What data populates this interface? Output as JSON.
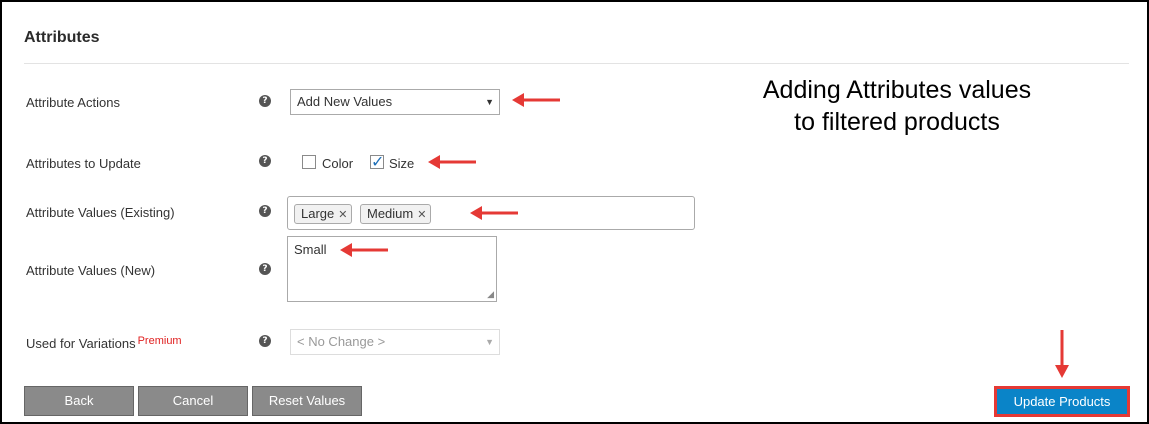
{
  "section": {
    "title": "Attributes"
  },
  "rows": {
    "actions": {
      "label": "Attribute Actions",
      "value": "Add New Values"
    },
    "update": {
      "label": "Attributes to Update",
      "options": [
        {
          "label": "Color",
          "checked": false
        },
        {
          "label": "Size",
          "checked": true
        }
      ]
    },
    "existing": {
      "label": "Attribute Values (Existing)",
      "tags": [
        "Large",
        "Medium"
      ]
    },
    "new": {
      "label": "Attribute Values (New)",
      "value": "Small"
    },
    "variations": {
      "label": "Used for Variations",
      "badge": "Premium",
      "value": "< No Change >"
    }
  },
  "help_glyph": "?",
  "buttons": {
    "back": "Back",
    "cancel": "Cancel",
    "reset": "Reset Values",
    "update": "Update Products"
  },
  "annotation": {
    "line1": "Adding Attributes values",
    "line2": "to filtered products"
  },
  "icons": {
    "help": "help-icon",
    "arrow": "red-arrow",
    "remove": "remove-tag-icon",
    "caret": "caret-down-icon",
    "check": "checkmark-icon"
  },
  "colors": {
    "primary": "#0a84c8",
    "highlight": "#e53935",
    "secondary": "#8a8a8a",
    "premium": "#e02020"
  }
}
